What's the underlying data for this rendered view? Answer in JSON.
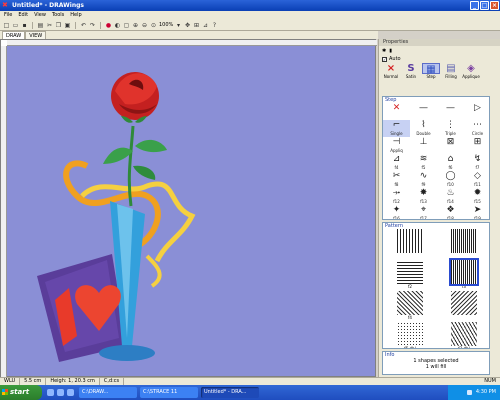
{
  "window": {
    "title": "Untitled* - DRAWings"
  },
  "menu": [
    "File",
    "Edit",
    "View",
    "Tools",
    "Help"
  ],
  "toolbar": {
    "zoom": "100%"
  },
  "tabs": [
    "DRAW",
    "VIEW"
  ],
  "panel": {
    "title": "Properties",
    "auto_label": "Auto",
    "modes": [
      {
        "label": "Normal",
        "icon": "×"
      },
      {
        "label": "Satin",
        "icon": "S"
      },
      {
        "label": "Step",
        "icon": "▦"
      },
      {
        "label": "Filling",
        "icon": "▤"
      },
      {
        "label": "Applique",
        "icon": "◈"
      }
    ],
    "stitch_header": "Step",
    "stitches": [
      {
        "glyph": "✕",
        "label": ""
      },
      {
        "glyph": "—",
        "label": ""
      },
      {
        "glyph": "—",
        "label": ""
      },
      {
        "glyph": "▷",
        "label": ""
      },
      {
        "glyph": "⌐",
        "label": "Single"
      },
      {
        "glyph": "⌇",
        "label": "Double"
      },
      {
        "glyph": "⋮",
        "label": "Triple"
      },
      {
        "glyph": "⋯",
        "label": "Circle"
      },
      {
        "glyph": "⊣",
        "label": "Appliq"
      },
      {
        "glyph": "⊥",
        "label": ""
      },
      {
        "glyph": "⊠",
        "label": ""
      },
      {
        "glyph": "⊞",
        "label": ""
      },
      {
        "glyph": "⊿",
        "label": "f4"
      },
      {
        "glyph": "≋",
        "label": "f5"
      },
      {
        "glyph": "⌂",
        "label": "f6"
      },
      {
        "glyph": "↯",
        "label": "f7"
      },
      {
        "glyph": "✂",
        "label": "f8"
      },
      {
        "glyph": "∿",
        "label": "f9"
      },
      {
        "glyph": "◯",
        "label": "f10"
      },
      {
        "glyph": "◇",
        "label": "f11"
      },
      {
        "glyph": "⤞",
        "label": "f12"
      },
      {
        "glyph": "✸",
        "label": "f13"
      },
      {
        "glyph": "♨",
        "label": "f14"
      },
      {
        "glyph": "✹",
        "label": "f15"
      },
      {
        "glyph": "✦",
        "label": "f16"
      },
      {
        "glyph": "⌖",
        "label": "f17"
      },
      {
        "glyph": "❖",
        "label": "f18"
      },
      {
        "glyph": "➤",
        "label": "f19"
      }
    ],
    "pattern_header": "Pattern",
    "patterns": [
      {
        "label": "",
        "style": "p1"
      },
      {
        "label": "",
        "style": "p2"
      },
      {
        "label": "f2",
        "style": "p6"
      },
      {
        "label": "f3",
        "style": "p2"
      },
      {
        "label": "f4",
        "style": "p3"
      },
      {
        "label": "",
        "style": "p4"
      },
      {
        "label": "f5 dbl",
        "style": "p5"
      },
      {
        "label": "f3 dbl",
        "style": "p7"
      },
      {
        "label": "",
        "style": "p8"
      },
      {
        "label": "",
        "style": "p3"
      }
    ],
    "info_header": "Info",
    "info_line1": "1 shapes selected",
    "info_line2": "1 will fill"
  },
  "status": {
    "cells": [
      "WLU",
      "5.5 cm",
      "Heigh: 1, 20.3 cm",
      "C,d:cs"
    ],
    "right": "NUM"
  },
  "taskbar": {
    "start": "start",
    "tasks": [
      {
        "label": "C:\\DRAW...",
        "active": false
      },
      {
        "label": "C:\\STRACE 11",
        "active": false
      },
      {
        "label": "Untitled* - DRA...",
        "active": true
      }
    ],
    "clock": "4:30 PM"
  },
  "colors": {
    "canvas_bg": "#8a8fd6",
    "titlebar": "#0a3fb4",
    "taskbar": "#1f4dbf"
  }
}
